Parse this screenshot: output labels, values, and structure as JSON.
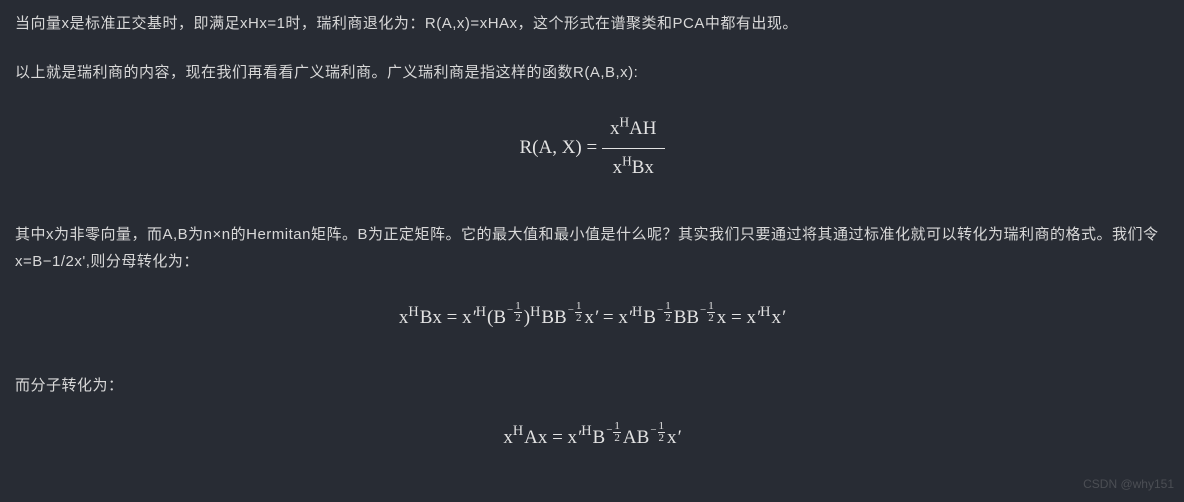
{
  "paragraphs": {
    "p1": "当向量x是标准正交基时，即满足xHx=1时，瑞利商退化为：R(A,x)=xHAx，这个形式在谱聚类和PCA中都有出现。",
    "p2": "以上就是瑞利商的内容，现在我们再看看广义瑞利商。广义瑞利商是指这样的函数R(A,B,x):",
    "p3": "其中x为非零向量，而A,B为n×n的Hermitan矩阵。B为正定矩阵。它的最大值和最小值是什么呢？其实我们只要通过将其通过标准化就可以转化为瑞利商的格式。我们令x=B−1/2x',则分母转化为：",
    "p4": "而分子转化为："
  },
  "equations": {
    "eq1": {
      "lhs": "R(A, X) = ",
      "num": "x<sup>H</sup>AH",
      "den": "x<sup>H</sup>Bx"
    },
    "eq2": "x<sup class=\"H-sup\">H</sup>Bx = x<span class=\"prime\">′</span><sup class=\"H-sup\">H</sup>(B<span class=\"neg-half-exp\"><span class=\"mn\">−</span><span class=\"sf\"><span class=\"t\">1</span><span class=\"b\">2</span></span></span>)<sup class=\"H-sup\">H</sup>BB<span class=\"neg-half-exp\"><span class=\"mn\">−</span><span class=\"sf\"><span class=\"t\">1</span><span class=\"b\">2</span></span></span>x<span class=\"prime\">′</span> = x<span class=\"prime\">′</span><sup class=\"H-sup\">H</sup>B<span class=\"neg-half-exp\"><span class=\"mn\">−</span><span class=\"sf\"><span class=\"t\">1</span><span class=\"b\">2</span></span></span>BB<span class=\"neg-half-exp\"><span class=\"mn\">−</span><span class=\"sf\"><span class=\"t\">1</span><span class=\"b\">2</span></span></span>x = x<span class=\"prime\">′</span><sup class=\"H-sup\">H</sup>x<span class=\"prime\">′</span>",
    "eq3": "x<sup class=\"H-sup\">H</sup>Ax = x<span class=\"prime\">′</span><sup class=\"H-sup\">H</sup>B<span class=\"neg-half-exp\"><span class=\"mn\">−</span><span class=\"sf\"><span class=\"t\">1</span><span class=\"b\">2</span></span></span>AB<span class=\"neg-half-exp\"><span class=\"mn\">−</span><span class=\"sf\"><span class=\"t\">1</span><span class=\"b\">2</span></span></span>x<span class=\"prime\">′</span>"
  },
  "watermark": "CSDN @why151"
}
